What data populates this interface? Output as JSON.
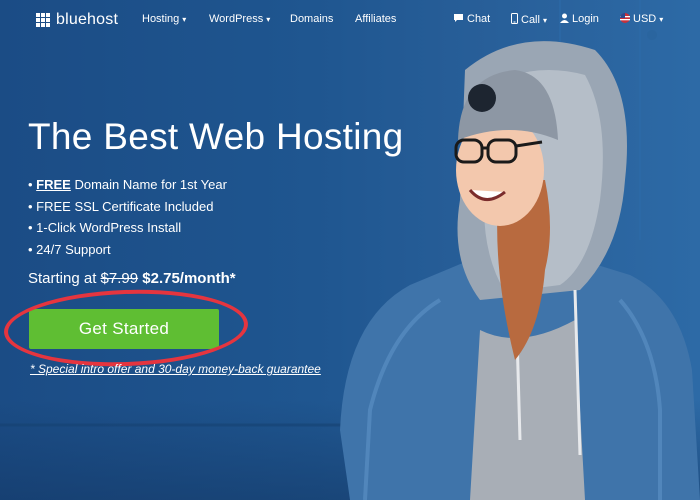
{
  "nav": {
    "logo": "bluehost",
    "items": [
      {
        "label": "Hosting",
        "caret": "▾"
      },
      {
        "label": "WordPress",
        "caret": "▾"
      },
      {
        "label": "Domains"
      },
      {
        "label": "Affiliates"
      }
    ],
    "chat": "Chat",
    "call": "Call",
    "login": "Login",
    "currency": "USD"
  },
  "hero": {
    "title": "The Best Web Hosting",
    "features": [
      {
        "bold": "FREE",
        "rest": " Domain Name for 1st Year"
      },
      {
        "text": "FREE SSL Certificate Included"
      },
      {
        "text": "1-Click WordPress Install"
      },
      {
        "text": "24/7 Support"
      }
    ],
    "price_prefix": "Starting at ",
    "price_old": "$7.99",
    "price_new": "$2.75/month*",
    "cta": "Get Started",
    "disclaimer": "* Special intro offer and 30-day money-back guarantee"
  },
  "colors": {
    "background": "#1f5690",
    "cta": "#5fbe33",
    "annotation_ring": "#e5353f"
  }
}
